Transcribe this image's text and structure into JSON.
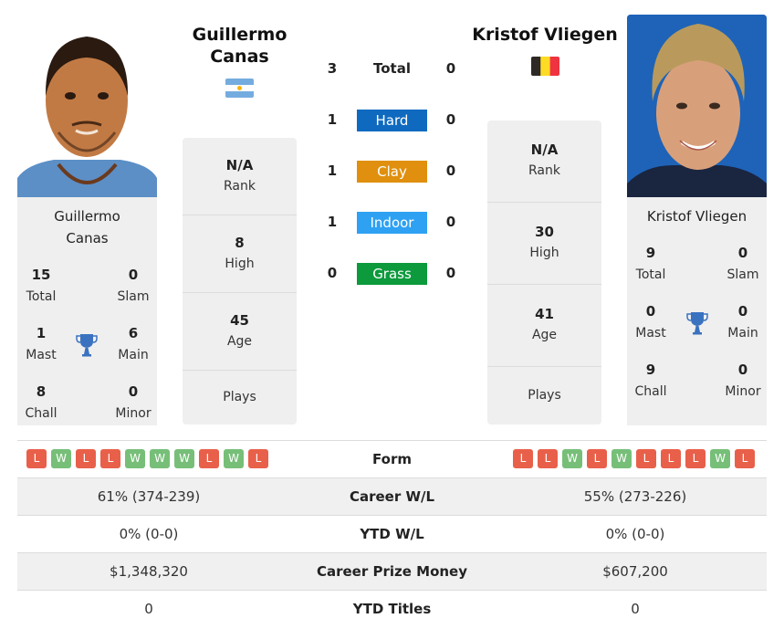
{
  "players": {
    "left": {
      "name": "Guillermo Canas",
      "name_line1": "Guillermo",
      "name_line2": "Canas",
      "country": "Argentina",
      "flag_icon": "argentina-flag-icon",
      "photo_alt": "Guillermo Canas photo",
      "titles": {
        "total": "15",
        "total_label": "Total",
        "slam": "0",
        "slam_label": "Slam",
        "mast": "1",
        "mast_label": "Mast",
        "main": "6",
        "main_label": "Main",
        "chall": "8",
        "chall_label": "Chall",
        "minor": "0",
        "minor_label": "Minor"
      },
      "rank": {
        "value": "N/A",
        "label": "Rank"
      },
      "high": {
        "value": "8",
        "label": "High"
      },
      "age": {
        "value": "45",
        "label": "Age"
      },
      "plays": {
        "value": "",
        "label": "Plays"
      }
    },
    "right": {
      "name": "Kristof Vliegen",
      "country": "Belgium",
      "flag_icon": "belgium-flag-icon",
      "photo_alt": "Kristof Vliegen photo",
      "titles": {
        "total": "9",
        "total_label": "Total",
        "slam": "0",
        "slam_label": "Slam",
        "mast": "0",
        "mast_label": "Mast",
        "main": "0",
        "main_label": "Main",
        "chall": "9",
        "chall_label": "Chall",
        "minor": "0",
        "minor_label": "Minor"
      },
      "rank": {
        "value": "N/A",
        "label": "Rank"
      },
      "high": {
        "value": "30",
        "label": "High"
      },
      "age": {
        "value": "41",
        "label": "Age"
      },
      "plays": {
        "value": "",
        "label": "Plays"
      }
    }
  },
  "h2h": {
    "total": {
      "label": "Total",
      "left": "3",
      "right": "0"
    },
    "surfaces": [
      {
        "label": "Hard",
        "left": "1",
        "right": "0",
        "color": "#0f6abf"
      },
      {
        "label": "Clay",
        "left": "1",
        "right": "0",
        "color": "#e0900e"
      },
      {
        "label": "Indoor",
        "left": "1",
        "right": "0",
        "color": "#2ea1f2"
      },
      {
        "label": "Grass",
        "left": "0",
        "right": "0",
        "color": "#0c9a3c"
      }
    ]
  },
  "comparison": {
    "form": {
      "label": "Form",
      "left": [
        "L",
        "W",
        "L",
        "L",
        "W",
        "W",
        "W",
        "L",
        "W",
        "L"
      ],
      "right": [
        "L",
        "L",
        "W",
        "L",
        "W",
        "L",
        "L",
        "L",
        "W",
        "L"
      ]
    },
    "rows": [
      {
        "label": "Career W/L",
        "left": "61% (374-239)",
        "right": "55% (273-226)"
      },
      {
        "label": "YTD W/L",
        "left": "0% (0-0)",
        "right": "0% (0-0)"
      },
      {
        "label": "Career Prize Money",
        "left": "$1,348,320",
        "right": "$607,200"
      },
      {
        "label": "YTD Titles",
        "left": "0",
        "right": "0"
      }
    ]
  },
  "colors": {
    "loss": "#e8604a",
    "win": "#77bf79",
    "trophy": "#3a72c0",
    "card_bg": "#efefef"
  }
}
